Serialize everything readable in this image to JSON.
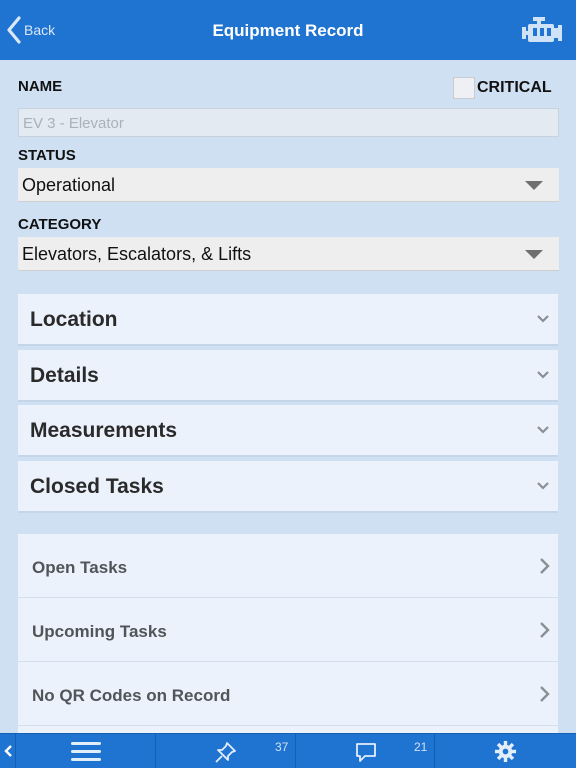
{
  "navbar": {
    "back_label": "Back",
    "title": "Equipment Record",
    "right_icon": "engine-icon"
  },
  "form": {
    "name_label": "NAME",
    "name_placeholder": "EV 3 - Elevator",
    "critical_label": "CRITICAL",
    "critical_checked": false,
    "status_label": "STATUS",
    "status_value": "Operational",
    "category_label": "CATEGORY",
    "category_value": "Elevators, Escalators, & Lifts"
  },
  "sections": [
    {
      "label": "Location"
    },
    {
      "label": "Details"
    },
    {
      "label": "Measurements"
    },
    {
      "label": "Closed Tasks"
    }
  ],
  "links": [
    {
      "label": "Open Tasks"
    },
    {
      "label": "Upcoming Tasks"
    },
    {
      "label": "No QR Codes on Record"
    }
  ],
  "tabbar": {
    "tabs": [
      {
        "icon": "collapse-left-icon"
      },
      {
        "icon": "menu-icon"
      },
      {
        "icon": "pin-icon",
        "badge": "37"
      },
      {
        "icon": "chat-icon",
        "badge": "21"
      },
      {
        "icon": "gear-icon"
      }
    ]
  },
  "colors": {
    "nav_blue": "#1f74d1",
    "background": "#cfe0f3",
    "row_bg": "#ecf2fb"
  }
}
